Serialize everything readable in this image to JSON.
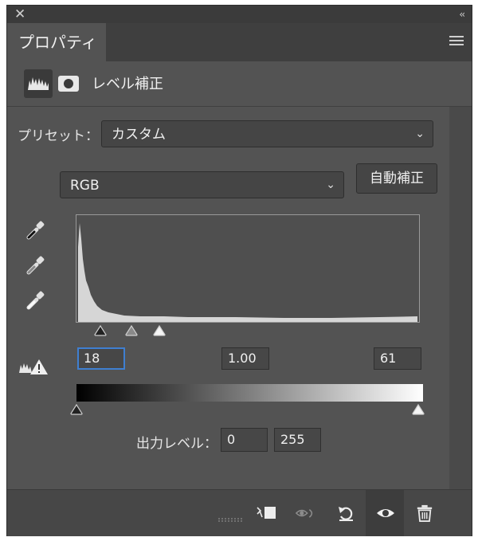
{
  "panel": {
    "tab_label": "プロパティ",
    "adjustment_title": "レベル補正"
  },
  "preset": {
    "label": "プリセット：",
    "value": "カスタム"
  },
  "channel": {
    "value": "RGB",
    "auto_button": "自動補正"
  },
  "input_levels": {
    "black": "18",
    "gamma": "1.00",
    "white": "61"
  },
  "output_levels": {
    "label": "出力レベル：",
    "black": "0",
    "white": "255"
  },
  "icons": {
    "close": "close-icon",
    "collapse": "collapse-icon",
    "menu": "panel-menu-icon",
    "levels": "levels-adjustment-icon",
    "mask": "layer-mask-icon",
    "eyedropper_black": "black-point-eyedropper-icon",
    "eyedropper_gray": "gray-point-eyedropper-icon",
    "eyedropper_white": "white-point-eyedropper-icon",
    "clipping_warning": "clipping-warning-icon",
    "clip_to_layer": "clip-to-layer-icon",
    "view_previous": "view-previous-state-icon",
    "reset": "reset-icon",
    "visibility": "visibility-eye-icon",
    "delete": "trash-icon"
  },
  "colors": {
    "panel_bg": "#535353",
    "focus_border": "#3f7fd1"
  }
}
